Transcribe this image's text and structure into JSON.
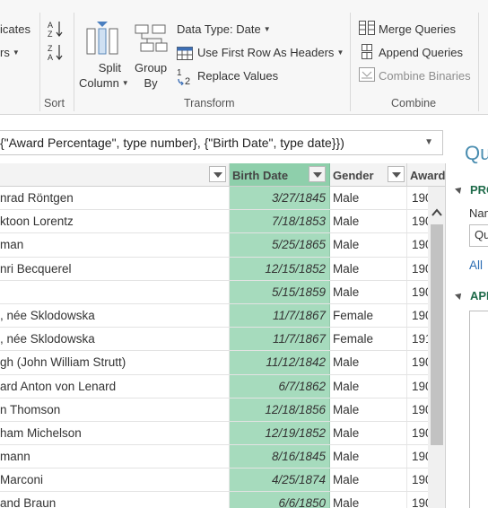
{
  "ribbon": {
    "cut_top_label": "icates",
    "cut_bottom_label": "rs",
    "sort": {
      "group": "Sort"
    },
    "transform": {
      "split_column": [
        "Split",
        "Column"
      ],
      "group_by": [
        "Group",
        "By"
      ],
      "data_type": "Data Type: Date",
      "first_row_headers": "Use First Row As Headers",
      "replace_values": "Replace Values",
      "group": "Transform"
    },
    "combine": {
      "merge": "Merge Queries",
      "append": "Append Queries",
      "binaries": "Combine Binaries",
      "group": "Combine"
    }
  },
  "formula": {
    "text": "\"Award Percentage\", type number}, {\"Birth Date\", type date}})"
  },
  "grid": {
    "headers": {
      "name": "",
      "birth_date": "Birth Date",
      "gender": "Gender",
      "award": "Award"
    },
    "rows": [
      {
        "name": "nrad Röntgen",
        "date": "3/27/1845",
        "gender": "Male",
        "award": "190"
      },
      {
        "name": "ktoon Lorentz",
        "date": "7/18/1853",
        "gender": "Male",
        "award": "190"
      },
      {
        "name": "man",
        "date": "5/25/1865",
        "gender": "Male",
        "award": "190"
      },
      {
        "name": "nri Becquerel",
        "date": "12/15/1852",
        "gender": "Male",
        "award": "190"
      },
      {
        "name": "",
        "date": "5/15/1859",
        "gender": "Male",
        "award": "190"
      },
      {
        "name": ", née Sklodowska",
        "date": "11/7/1867",
        "gender": "Female",
        "award": "190"
      },
      {
        "name": ", née Sklodowska",
        "date": "11/7/1867",
        "gender": "Female",
        "award": "191"
      },
      {
        "name": "gh (John William Strutt)",
        "date": "11/12/1842",
        "gender": "Male",
        "award": "190"
      },
      {
        "name": "ard Anton von Lenard",
        "date": "6/7/1862",
        "gender": "Male",
        "award": "190"
      },
      {
        "name": "n Thomson",
        "date": "12/18/1856",
        "gender": "Male",
        "award": "190"
      },
      {
        "name": "ham Michelson",
        "date": "12/19/1852",
        "gender": "Male",
        "award": "190"
      },
      {
        "name": "mann",
        "date": "8/16/1845",
        "gender": "Male",
        "award": "190"
      },
      {
        "name": "Marconi",
        "date": "4/25/1874",
        "gender": "Male",
        "award": "190"
      },
      {
        "name": "and Braun",
        "date": "6/6/1850",
        "gender": "Male",
        "award": "190"
      }
    ]
  },
  "pane": {
    "title": "Qu",
    "properties": "PRO",
    "name_label": "Nam",
    "name_value": "Qu",
    "all_link": "All",
    "applied": "APP"
  },
  "colors": {
    "selected_column": "#a6dbbd",
    "selected_header": "#8ecfab",
    "accent": "#1f6b4a"
  }
}
